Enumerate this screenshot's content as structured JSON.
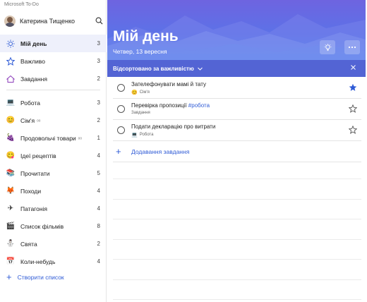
{
  "app": {
    "title": "Microsoft To-Do"
  },
  "user": {
    "name": "Катерина Тищенко"
  },
  "sidebar": {
    "smart_lists": [
      {
        "label": "Мій день",
        "count": "3",
        "icon": "sun-icon",
        "active": true
      },
      {
        "label": "Важливо",
        "count": "3",
        "icon": "star-icon"
      },
      {
        "label": "Завдання",
        "count": "2",
        "icon": "home-icon"
      }
    ],
    "lists": [
      {
        "label": "Робота",
        "count": "3",
        "icon": "laptop-emoji",
        "shared": false
      },
      {
        "label": "Сім'я",
        "count": "2",
        "icon": "family-emoji",
        "shared": true
      },
      {
        "label": "Продовольчі товари",
        "count": "1",
        "icon": "grapes-emoji",
        "shared": true
      },
      {
        "label": "Ідеї рецептів",
        "count": "4",
        "icon": "yum-emoji",
        "shared": false
      },
      {
        "label": "Прочитати",
        "count": "5",
        "icon": "books-emoji",
        "shared": false
      },
      {
        "label": "Походи",
        "count": "4",
        "icon": "fox-emoji",
        "shared": false
      },
      {
        "label": "Патагонія",
        "count": "4",
        "icon": "airplane-emoji",
        "shared": false
      },
      {
        "label": "Список фільмів",
        "count": "8",
        "icon": "film-emoji",
        "shared": false
      },
      {
        "label": "Свята",
        "count": "2",
        "icon": "snowman-emoji",
        "shared": false
      },
      {
        "label": "Коли-небудь",
        "count": "4",
        "icon": "calendar-emoji",
        "shared": false
      }
    ],
    "shared_glyph": "ᵒᵒ",
    "create_list": "Створити список"
  },
  "main": {
    "title": "Мій день",
    "date": "Четвер, 13 вересня",
    "sort_label": "Відсортовано за важливістю",
    "add_task": "Додавання завдання",
    "tasks": [
      {
        "title": "Зателефонувати мамі й тату",
        "tag": "",
        "list": "Сім'я",
        "list_icon": "family-emoji",
        "important": true
      },
      {
        "title": "Перевірка пропозиції ",
        "tag": "#робота",
        "list": "Завдання",
        "list_icon": "",
        "important": false
      },
      {
        "title": "Подати декларацію про витрати",
        "tag": "",
        "list": "Робота",
        "list_icon": "laptop-emoji",
        "important": false
      }
    ]
  },
  "colors": {
    "accent": "#2f5bd6",
    "hero_top": "#6e64e0",
    "hero_bottom": "#4b86ef",
    "sortbar": "#5364d4"
  }
}
